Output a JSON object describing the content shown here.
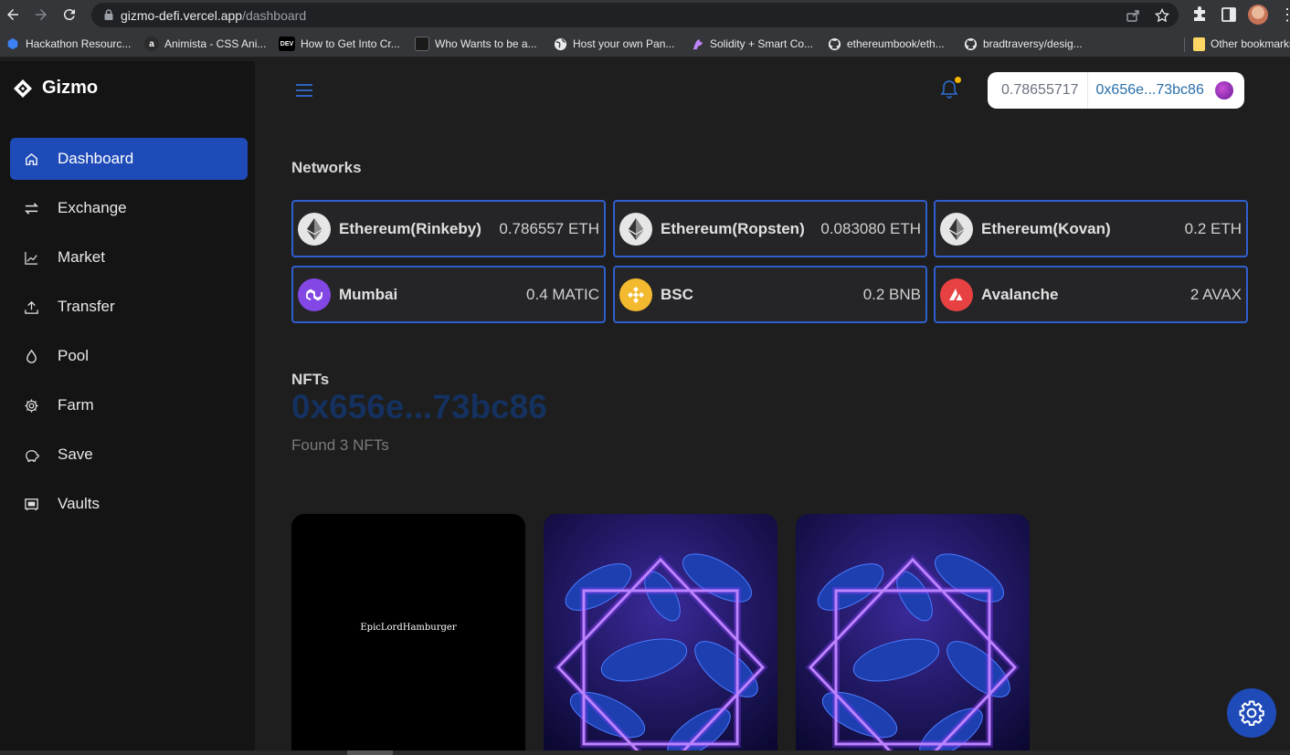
{
  "browser": {
    "url_host": "gizmo-defi.vercel.app",
    "url_path": "/dashboard",
    "bookmarks": [
      {
        "label": "Hackathon Resourc...",
        "icon": "hackathon-icon"
      },
      {
        "label": "Animista - CSS Ani...",
        "icon": "animista-icon"
      },
      {
        "label": "How to Get Into Cr...",
        "icon": "dev-icon"
      },
      {
        "label": "Who Wants to be a...",
        "icon": "quiz-icon"
      },
      {
        "label": "Host your own Pan...",
        "icon": "globe-icon"
      },
      {
        "label": "Solidity + Smart Co...",
        "icon": "unicorn-icon"
      },
      {
        "label": "ethereumbook/eth...",
        "icon": "github-icon"
      },
      {
        "label": "bradtraversy/desig...",
        "icon": "github-icon"
      }
    ],
    "other_bookmarks": "Other bookmarks",
    "dev_badge": "DEV"
  },
  "sidebar": {
    "brand": "Gizmo",
    "items": [
      {
        "label": "Dashboard",
        "icon": "home-icon",
        "active": true
      },
      {
        "label": "Exchange",
        "icon": "exchange-icon"
      },
      {
        "label": "Market",
        "icon": "chart-icon"
      },
      {
        "label": "Transfer",
        "icon": "upload-icon"
      },
      {
        "label": "Pool",
        "icon": "drop-icon"
      },
      {
        "label": "Farm",
        "icon": "gear-icon"
      },
      {
        "label": "Save",
        "icon": "piggy-icon"
      },
      {
        "label": "Vaults",
        "icon": "vault-icon"
      }
    ]
  },
  "header": {
    "balance": "0.78655717",
    "address": "0x656e...73bc86"
  },
  "networks": {
    "title": "Networks",
    "items": [
      {
        "name": "Ethereum(Rinkeby)",
        "amount": "0.786557 ETH",
        "icon": "ethereum-icon"
      },
      {
        "name": "Ethereum(Ropsten)",
        "amount": "0.083080 ETH",
        "icon": "ethereum-icon"
      },
      {
        "name": "Ethereum(Kovan)",
        "amount": "0.2 ETH",
        "icon": "ethereum-icon"
      },
      {
        "name": "Mumbai",
        "amount": "0.4 MATIC",
        "icon": "polygon-icon"
      },
      {
        "name": "BSC",
        "amount": "0.2 BNB",
        "icon": "bnb-icon"
      },
      {
        "name": "Avalanche",
        "amount": "2 AVAX",
        "icon": "avalanche-icon"
      }
    ]
  },
  "nfts": {
    "title": "NFTs",
    "address": "0x656e...73bc86",
    "found": "Found 3 NFTs",
    "items": [
      {
        "caption": "EpicLordHamburger"
      },
      {
        "caption": ""
      },
      {
        "caption": ""
      }
    ]
  },
  "colors": {
    "accent": "#1f4bb8",
    "card_border": "#2f5fcf",
    "sidebar_bg": "#141414",
    "main_bg": "#1e1e1e"
  }
}
